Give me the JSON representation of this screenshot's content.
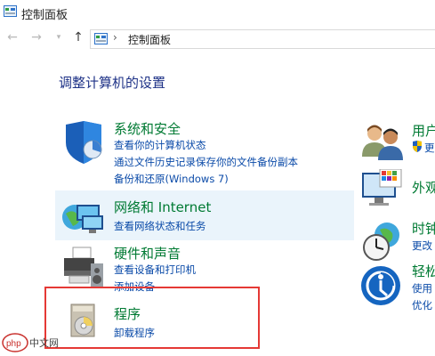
{
  "window": {
    "title": "控制面板"
  },
  "address": {
    "separator": "›",
    "crumb": "控制面板"
  },
  "main": {
    "heading": "调整计算机的设置"
  },
  "categories": [
    {
      "title": "系统和安全",
      "links": [
        "查看你的计算机状态",
        "通过文件历史记录保存你的文件备份副本",
        "备份和还原(Windows 7)"
      ]
    },
    {
      "title": "网络和 Internet",
      "links": [
        "查看网络状态和任务"
      ]
    },
    {
      "title": "硬件和声音",
      "links": [
        "查看设备和打印机",
        "添加设备"
      ]
    },
    {
      "title": "程序",
      "links": [
        "卸载程序"
      ]
    }
  ],
  "right_categories": [
    {
      "title": "用户",
      "links": [
        "更"
      ]
    },
    {
      "title": "外观",
      "links": []
    },
    {
      "title": "时钟",
      "links": [
        "更改"
      ]
    },
    {
      "title": "轻松",
      "links": [
        "使用",
        "优化"
      ]
    }
  ],
  "watermark": {
    "text": "php 中文网"
  },
  "colors": {
    "heading": "#1e3287",
    "category_title": "#007a33",
    "link": "#0a4aa8",
    "highlight": "#eaf4fb",
    "selection_box": "#e53935"
  }
}
